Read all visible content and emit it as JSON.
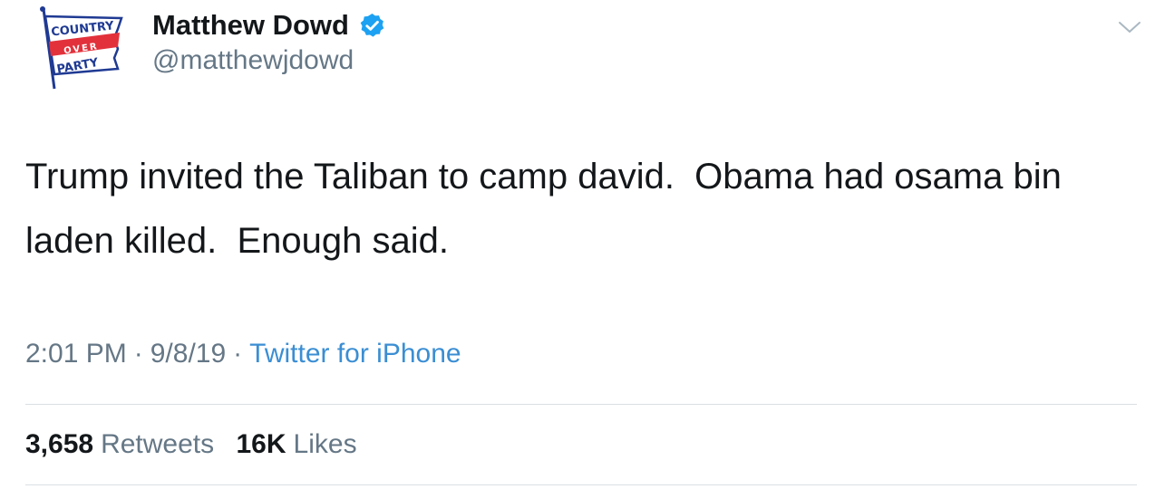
{
  "user": {
    "display_name": "Matthew Dowd",
    "handle": "@matthewjdowd",
    "verified": true,
    "avatar_logo_text": [
      "COUNTRY",
      "OVER",
      "PARTY"
    ]
  },
  "tweet": {
    "text": "Trump invited the Taliban to camp david.  Obama had osama bin laden killed.  Enough said.",
    "time": "2:01 PM",
    "date": "9/8/19",
    "separator": "·",
    "source": "Twitter for iPhone"
  },
  "stats": {
    "retweets_count": "3,658",
    "retweets_label": "Retweets",
    "likes_count": "16K",
    "likes_label": "Likes"
  },
  "icons": {
    "verified": "verified-badge-icon",
    "caret": "chevron-down-icon"
  },
  "colors": {
    "text": "#14171a",
    "secondary": "#657786",
    "link": "#3b8ed3",
    "verified": "#1da1f2",
    "divider": "#dadfe3",
    "logo_blue": "#1f3a93",
    "logo_red": "#e2313b"
  }
}
